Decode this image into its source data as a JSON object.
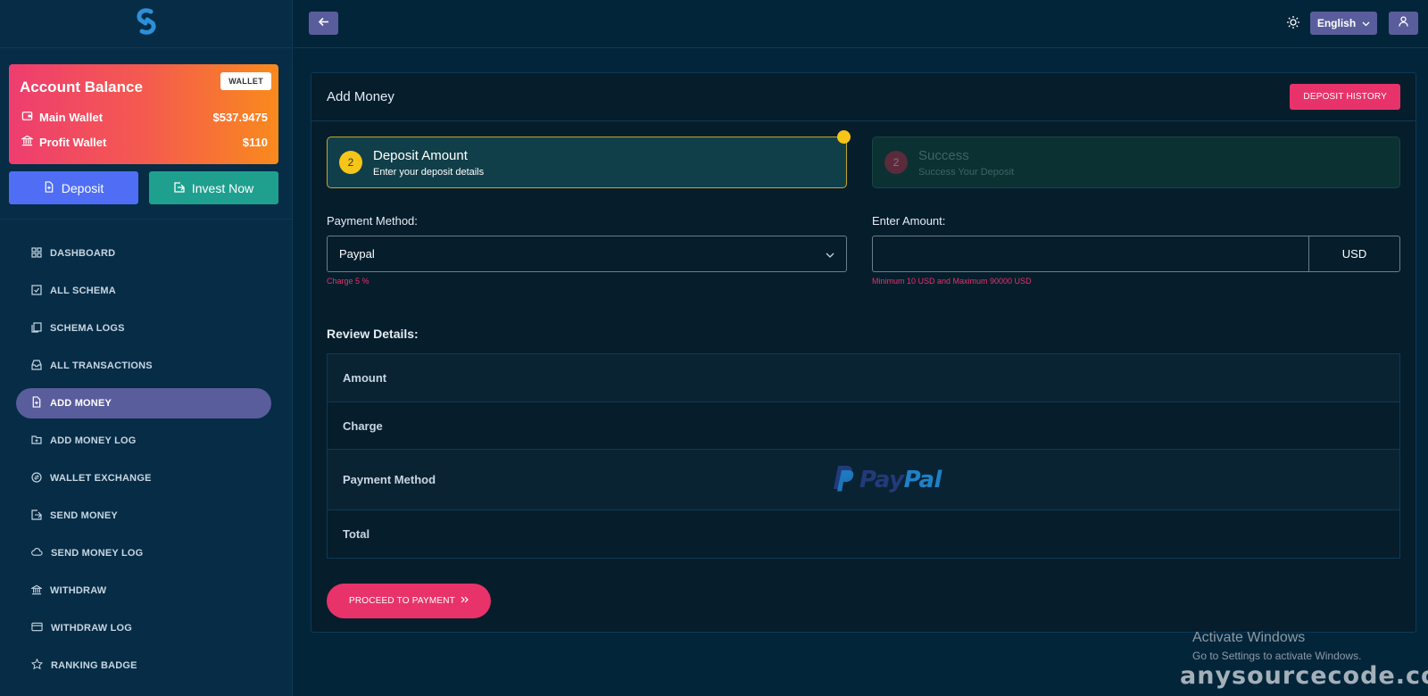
{
  "sidebar": {
    "logo_icon": "s-logo-icon",
    "balance": {
      "title": "Account Balance",
      "badge": "WALLET",
      "main_wallet_label": "Main Wallet",
      "main_wallet_value": "$537.9475",
      "profit_wallet_label": "Profit Wallet",
      "profit_wallet_value": "$110"
    },
    "deposit_label": "Deposit",
    "invest_label": "Invest Now",
    "nav": [
      {
        "label": "DASHBOARD",
        "icon": "grid-icon"
      },
      {
        "label": "ALL SCHEMA",
        "icon": "checkbox-icon"
      },
      {
        "label": "SCHEMA LOGS",
        "icon": "copy-icon"
      },
      {
        "label": "ALL TRANSACTIONS",
        "icon": "inbox-icon"
      },
      {
        "label": "ADD MONEY",
        "icon": "file-plus-icon",
        "active": true
      },
      {
        "label": "ADD MONEY LOG",
        "icon": "folder-plus-icon"
      },
      {
        "label": "WALLET EXCHANGE",
        "icon": "exchange-icon"
      },
      {
        "label": "SEND MONEY",
        "icon": "send-icon"
      },
      {
        "label": "SEND MONEY LOG",
        "icon": "cloud-icon"
      },
      {
        "label": "WITHDRAW",
        "icon": "bank-icon"
      },
      {
        "label": "WITHDRAW LOG",
        "icon": "card-icon"
      },
      {
        "label": "RANKING BADGE",
        "icon": "star-icon"
      }
    ]
  },
  "topbar": {
    "language": "English"
  },
  "main": {
    "title": "Add Money",
    "history_button": "DEPOSIT HISTORY",
    "steps": [
      {
        "num": "2",
        "title": "Deposit Amount",
        "subtitle": "Enter your deposit details"
      },
      {
        "num": "2",
        "title": "Success",
        "subtitle": "Success Your Deposit"
      }
    ],
    "payment_method_label": "Payment Method:",
    "payment_method_value": "Paypal",
    "charge_hint": "Charge 5 %",
    "amount_label": "Enter Amount:",
    "amount_value": "",
    "currency": "USD",
    "amount_hint": "Minimum 10 USD and Maximum 90000 USD",
    "review_title": "Review Details:",
    "review_rows": [
      "Amount",
      "Charge",
      "Payment Method",
      "Total"
    ],
    "paypal_logo_1": "Pay",
    "paypal_logo_2": "Pal",
    "proceed_button": "PROCEED TO PAYMENT"
  },
  "overlay": {
    "activate_title": "Activate Windows",
    "activate_sub": "Go to Settings to activate Windows.",
    "watermark": "anysourcecode.com"
  },
  "colors": {
    "accent": "#e8336a",
    "sidebar_active": "#5a5d9c",
    "step_active_border": "#c6a628"
  }
}
